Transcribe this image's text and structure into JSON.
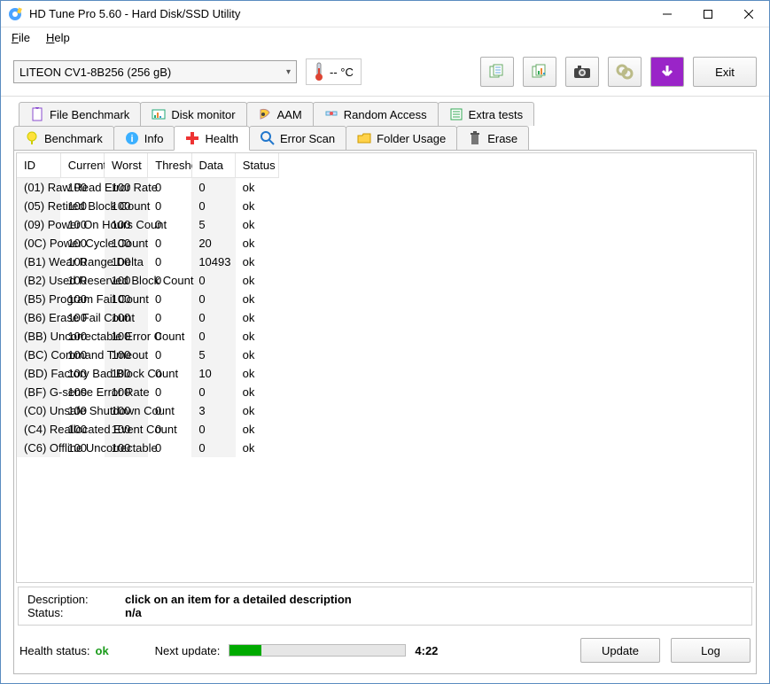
{
  "title": "HD Tune Pro 5.60 - Hard Disk/SSD Utility",
  "menu": {
    "file": "File",
    "help": "Help"
  },
  "toolbar": {
    "drive": "LITEON CV1-8B256 (256 gB)",
    "temp": "-- °C",
    "exit": "Exit"
  },
  "tabs_upper": [
    {
      "label": "File Benchmark",
      "icon": "file-benchmark"
    },
    {
      "label": "Disk monitor",
      "icon": "disk-monitor"
    },
    {
      "label": "AAM",
      "icon": "aam"
    },
    {
      "label": "Random Access",
      "icon": "random-access"
    },
    {
      "label": "Extra tests",
      "icon": "extra-tests"
    }
  ],
  "tabs_lower": [
    {
      "label": "Benchmark",
      "icon": "benchmark"
    },
    {
      "label": "Info",
      "icon": "info"
    },
    {
      "label": "Health",
      "icon": "health",
      "selected": true
    },
    {
      "label": "Error Scan",
      "icon": "error-scan"
    },
    {
      "label": "Folder Usage",
      "icon": "folder-usage"
    },
    {
      "label": "Erase",
      "icon": "erase"
    }
  ],
  "smart": {
    "headers": {
      "id": "ID",
      "current": "Current",
      "worst": "Worst",
      "threshold": "Threshold",
      "data": "Data",
      "status": "Status"
    },
    "rows": [
      {
        "id": "(01) Raw Read Error Rate",
        "current": "100",
        "worst": "100",
        "threshold": "0",
        "data": "0",
        "status": "ok"
      },
      {
        "id": "(05) Retired Block Count",
        "current": "100",
        "worst": "100",
        "threshold": "0",
        "data": "0",
        "status": "ok"
      },
      {
        "id": "(09) Power On Hours Count",
        "current": "100",
        "worst": "100",
        "threshold": "0",
        "data": "5",
        "status": "ok"
      },
      {
        "id": "(0C) Power Cycle Count",
        "current": "100",
        "worst": "100",
        "threshold": "0",
        "data": "20",
        "status": "ok"
      },
      {
        "id": "(B1) Wear Range Delta",
        "current": "100",
        "worst": "100",
        "threshold": "0",
        "data": "10493",
        "status": "ok"
      },
      {
        "id": "(B2) Used Reserved Block Count",
        "current": "100",
        "worst": "100",
        "threshold": "0",
        "data": "0",
        "status": "ok"
      },
      {
        "id": "(B5) Program Fail Count",
        "current": "100",
        "worst": "100",
        "threshold": "0",
        "data": "0",
        "status": "ok"
      },
      {
        "id": "(B6) Erase Fail Count",
        "current": "100",
        "worst": "100",
        "threshold": "0",
        "data": "0",
        "status": "ok"
      },
      {
        "id": "(BB) Uncorrectable Error Count",
        "current": "100",
        "worst": "100",
        "threshold": "0",
        "data": "0",
        "status": "ok"
      },
      {
        "id": "(BC) Command Timeout",
        "current": "100",
        "worst": "100",
        "threshold": "0",
        "data": "5",
        "status": "ok"
      },
      {
        "id": "(BD) Factory Bad Block Count",
        "current": "100",
        "worst": "100",
        "threshold": "0",
        "data": "10",
        "status": "ok"
      },
      {
        "id": "(BF) G-sense Error Rate",
        "current": "100",
        "worst": "100",
        "threshold": "0",
        "data": "0",
        "status": "ok"
      },
      {
        "id": "(C0) Unsafe Shutdown Count",
        "current": "100",
        "worst": "100",
        "threshold": "0",
        "data": "3",
        "status": "ok"
      },
      {
        "id": "(C4) Reallocated Event Count",
        "current": "100",
        "worst": "100",
        "threshold": "0",
        "data": "0",
        "status": "ok"
      },
      {
        "id": "(C6) Offline Uncorrectable",
        "current": "100",
        "worst": "100",
        "threshold": "0",
        "data": "0",
        "status": "ok"
      }
    ]
  },
  "description": {
    "desc_label": "Description:",
    "desc_value": "click on an item for a detailed description",
    "status_label": "Status:",
    "status_value": "n/a"
  },
  "footer": {
    "health_label": "Health status:",
    "health_value": "ok",
    "next_update_label": "Next update:",
    "next_update_value": "4:22",
    "progress_pct": 18,
    "update_btn": "Update",
    "log_btn": "Log"
  }
}
